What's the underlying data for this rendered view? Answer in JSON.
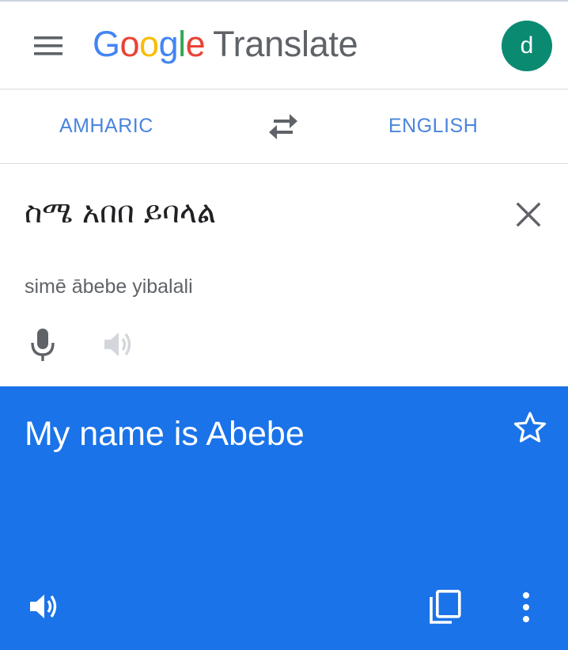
{
  "header": {
    "menu_icon": "hamburger-menu-icon",
    "logo": {
      "letters": [
        {
          "char": "G",
          "color": "#4285f4"
        },
        {
          "char": "o",
          "color": "#ea4335"
        },
        {
          "char": "o",
          "color": "#fbbc05"
        },
        {
          "char": "g",
          "color": "#4285f4"
        },
        {
          "char": "l",
          "color": "#34a853"
        },
        {
          "char": "e",
          "color": "#ea4335"
        }
      ],
      "product": "Translate"
    },
    "avatar_initial": "d",
    "avatar_color": "#0b8a72"
  },
  "languages": {
    "source": "AMHARIC",
    "target": "ENGLISH",
    "swap_icon": "swap-arrows-icon",
    "accent_color": "#4a85dc"
  },
  "input": {
    "source_text": "ስሜ አበበ ይባላል",
    "transliteration": "simē ābebe yibalali",
    "clear_icon": "close-icon",
    "mic_icon": "microphone-icon",
    "speaker_icon": "speaker-icon"
  },
  "result": {
    "translation": "My name is Abebe",
    "background_color": "#1a73e8",
    "star_icon": "star-outline-icon",
    "speaker_icon": "speaker-icon",
    "copy_icon": "copy-icon",
    "more_icon": "more-vert-icon"
  }
}
